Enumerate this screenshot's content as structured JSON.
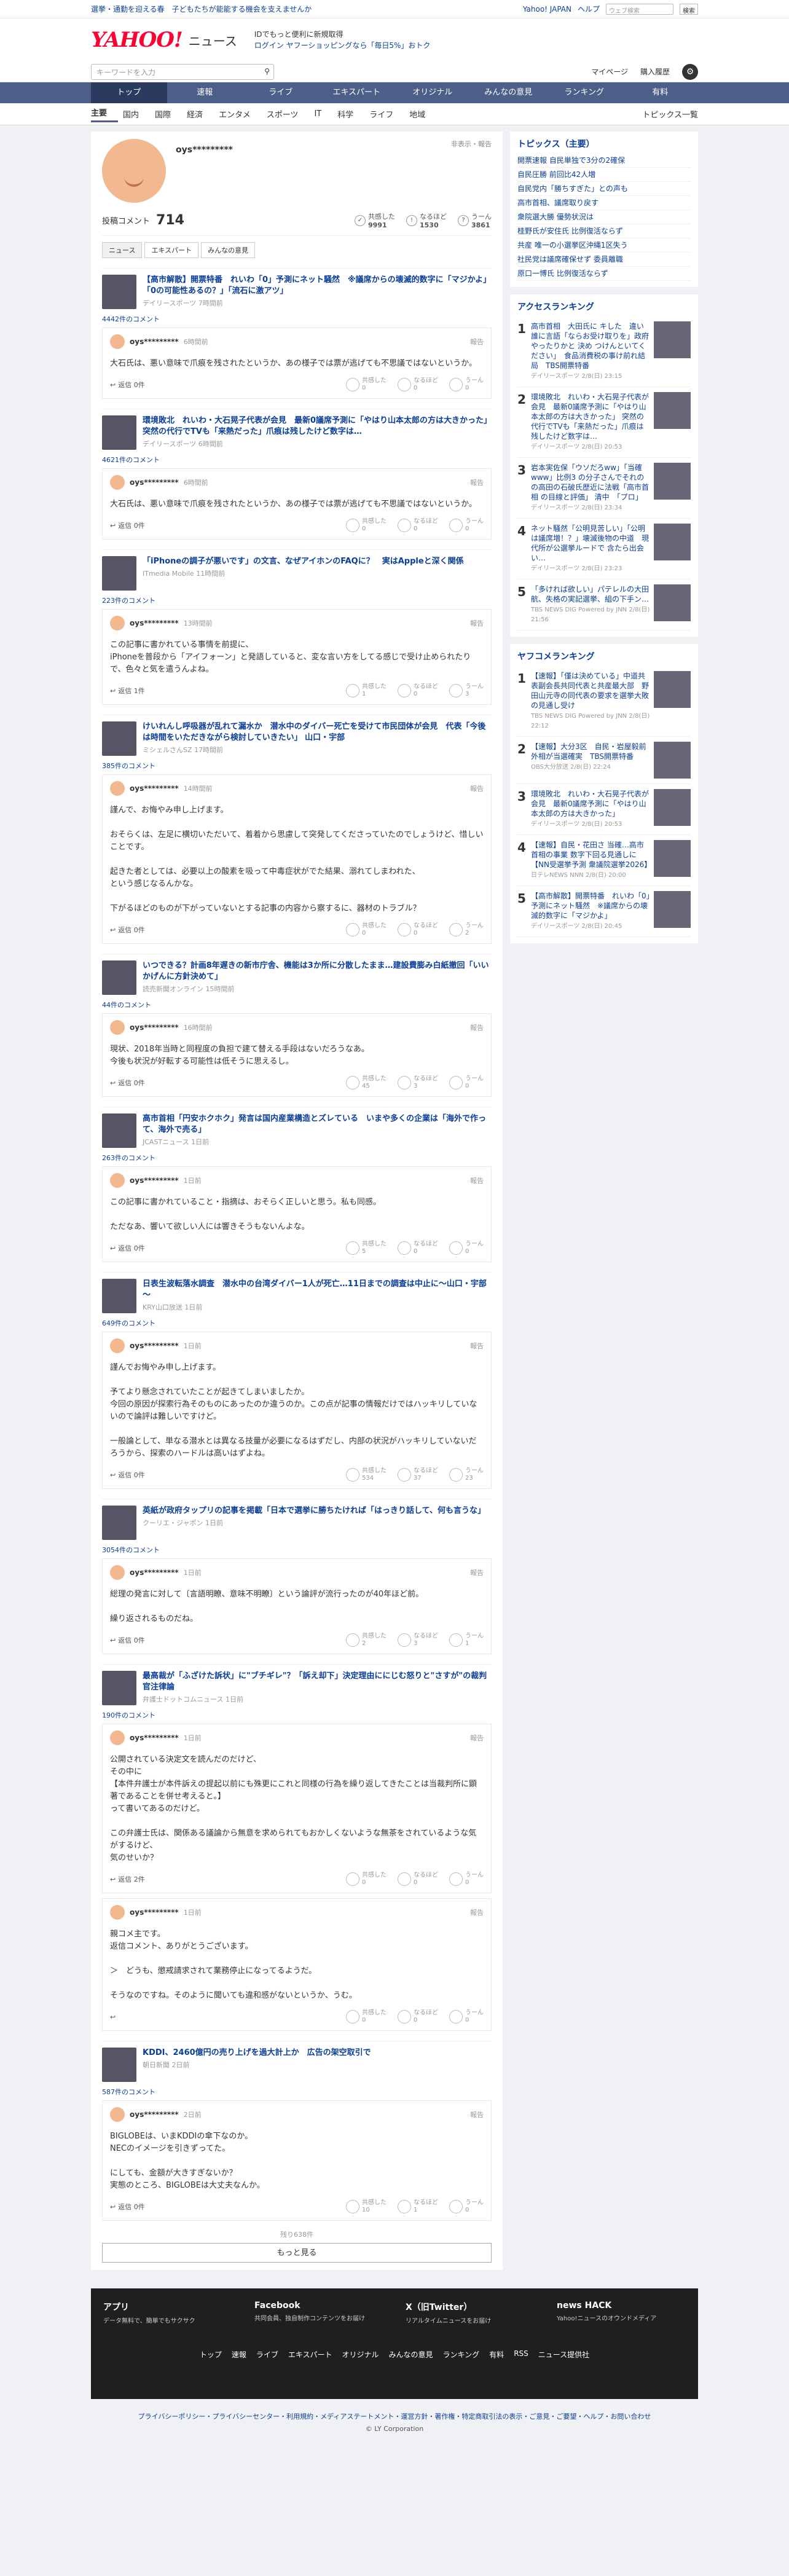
{
  "topbar": {
    "promo": "選挙・通勤を迎える春　子どもたちが能能する機会を支えませんか",
    "links": [
      "Yahoo! JAPAN",
      "ヘルプ"
    ],
    "search_placeholder": "ウェブ検索",
    "search_btn": "検索"
  },
  "header": {
    "logo": "YAHOO!",
    "logo_sub": "ニュース",
    "msg1": "IDでもっと便利に新規取得",
    "msg2": "ログイン ヤフーショッピングなら「毎日5%」おトク"
  },
  "search": {
    "placeholder": "キーワードを入力",
    "links": [
      "マイページ",
      "購入履歴"
    ]
  },
  "nav1": [
    "トップ",
    "速報",
    "ライブ",
    "エキスパート",
    "オリジナル",
    "みんなの意見",
    "ランキング",
    "有料"
  ],
  "nav2": [
    "主要",
    "国内",
    "国際",
    "経済",
    "エンタメ",
    "スポーツ",
    "IT",
    "科学",
    "ライフ",
    "地域"
  ],
  "nav2_right": "トピックス一覧",
  "profile": {
    "name": "oys*********",
    "meta": "非表示・報告",
    "label": "投稿コメント",
    "count": "714",
    "reacts": [
      {
        "label": "共感した",
        "num": "9991"
      },
      {
        "label": "なるほど",
        "num": "1530"
      },
      {
        "label": "うーん",
        "num": "3861"
      }
    ]
  },
  "tabs": [
    "ニュース",
    "エキスパート",
    "みんなの意見"
  ],
  "react_labels": [
    "共感した",
    "なるほど",
    "うーん"
  ],
  "articles": [
    {
      "title": "【高市解散】開票特番　れいわ「0」予測にネット騒然　※議席からの壊滅的数字に「マジかよ」「0の可能性あるの？」「流石に激アツ」",
      "src": "デイリースポーツ 7時間前",
      "count": "4442件のコメント",
      "comments": [
        {
          "name": "oys*********",
          "time": "6時間前",
          "body": "大石氏は、悪い意味で爪痕を残されたというか、あの様子では票が逃げても不思議ではないというか。",
          "reply": "返信 0件",
          "r": [
            "0",
            "0",
            "0"
          ]
        }
      ]
    },
    {
      "title": "環境敗北　れいわ・大石晃子代表が会見　最新0議席予測に「やはり山本太郎の方は大きかった」　突然の代行でTVも「来熱だった」爪痕は残したけど数字は…",
      "src": "デイリースポーツ 6時間前",
      "count": "4621件のコメント",
      "comments": [
        {
          "name": "oys*********",
          "time": "6時間前",
          "body": "大石氏は、悪い意味で爪痕を残されたというか、あの様子では票が逃げても不思議ではないというか。",
          "reply": "返信 0件",
          "r": [
            "0",
            "0",
            "0"
          ]
        }
      ]
    },
    {
      "title": "「iPhoneの調子が悪いです」の文言、なぜアイホンのFAQに？　実はAppleと深く関係",
      "src": "ITmedia Mobile 11時間前",
      "count": "223件のコメント",
      "comments": [
        {
          "name": "oys*********",
          "time": "13時間前",
          "body": "この記事に書かれている事情を前提に、\niPhoneを普段から「アイフォーン」と発語していると、変な言い方をしてる感じで受け止められたりで、色々と気を遣うんよね。",
          "reply": "返信 1件",
          "r": [
            "1",
            "0",
            "3"
          ]
        }
      ]
    },
    {
      "title": "けいれんし呼吸器が乱れて漏水か　潜水中のダイバー死亡を受けて市民団体が会見　代表「今後は時間をいただきながら検討していきたい」 山口・宇部",
      "src": "ミシェルさんSZ 17時間前",
      "count": "385件のコメント",
      "comments": [
        {
          "name": "oys*********",
          "time": "14時間前",
          "body": "謹んで、お悔やみ申し上げます。\n\nおそらくは、左足に横切いただいて、着着から思慮して突発してくださっていたのでしょうけど、惜しいことです。\n\n起きた者としては、必要以上の酸素を吸って中毒症状がでた結果、溺れてしまわれた、\nという感じなるんかな。\n\n下がるほどのものが下がっていないとする記事の内容から察するに、器材のトラブル？",
          "reply": "返信 0件",
          "r": [
            "0",
            "0",
            "2"
          ]
        }
      ]
    },
    {
      "title": "いつできる？計画8年遅きの新市庁舎、機能は3か所に分散したまま…建設費膨み白紙撤回「いいかげんに方針決めて」",
      "src": "読売新聞オンライン 15時間前",
      "count": "44件のコメント",
      "comments": [
        {
          "name": "oys*********",
          "time": "16時間前",
          "body": "現状、2018年当時と同程度の負担で建て替える手段はないだろうなあ。\n今後も状況が好転する可能性は低そうに思えるし。",
          "reply": "返信 0件",
          "r": [
            "45",
            "3",
            "0"
          ]
        }
      ]
    },
    {
      "title": "高市首相「円安ホクホク」発言は国内産業構造とズレている　いまや多くの企業は「海外で作って、海外で売る」",
      "src": "JCASTニュース 1日前",
      "count": "263件のコメント",
      "comments": [
        {
          "name": "oys*********",
          "time": "1日前",
          "body": "この記事に書かれていること・指摘は、おそらく正しいと思う。私も同感。\n\nただなあ、響いて欲しい人には響きそうもないんよな。",
          "reply": "返信 0件",
          "r": [
            "5",
            "0",
            "0"
          ]
        }
      ]
    },
    {
      "title": "日表生波転落水調査　潜水中の台湾ダイバー1人が死亡…11日までの調査は中止に～山口・宇部～",
      "src": "KRY山口放送 1日前",
      "count": "649件のコメント",
      "comments": [
        {
          "name": "oys*********",
          "time": "1日前",
          "body": "謹んでお悔やみ申し上げます。\n\n予てより懸念されていたことが起きてしまいましたか。\n今回の原因が探索行為そのものにあったのか違うのか。この点が記事の情報だけではハッキリしていないので論評は難しいですけど。\n\n一般論として、単なる潜水とは異なる技量が必要になるはずだし、内部の状況がハッキリしていないだろうから、探索のハードルは高いはずよね。",
          "reply": "返信 0件",
          "r": [
            "534",
            "37",
            "23"
          ]
        }
      ]
    },
    {
      "title": "英紙が政府タップリの記事を掲載「日本で選挙に勝ちたければ「はっきり話して、何も言うな」",
      "src": "クーリエ・ジャポン 1日前",
      "count": "3054件のコメント",
      "comments": [
        {
          "name": "oys*********",
          "time": "1日前",
          "body": "総理の発言に対して〔言語明瞭、意味不明瞭〕という論評が流行ったのが40年ほど前。\n\n繰り返されるものだね。",
          "reply": "返信 0件",
          "r": [
            "2",
            "3",
            "1"
          ]
        }
      ]
    },
    {
      "title": "最高裁が「ふざけた訴状」に\"ブチギレ\"？「訴え却下」決定理由ににじむ怒りと\"さすが\"の裁判官注律論",
      "src": "弁護士ドットコムニュース 1日前",
      "count": "190件のコメント",
      "comments": [
        {
          "name": "oys*********",
          "time": "1日前",
          "body": "公開されている決定文を読んだのだけど、\nその中に\n【本件弁護士が本件訴えの提起以前にも殊更にこれと同様の行為を繰り返してきたことは当裁判所に顕著であることを併せ考えると。】\nって書いてあるのだけど。\n\nこの弁護士氏は、関係ある議論から無意を求められてもおかしくないような無茶をされているような気がするけど、\n気のせいか？",
          "reply": "返信 2件",
          "r": [
            "0",
            "0",
            "0"
          ]
        },
        {
          "name": "oys*********",
          "time": "1日前",
          "body": "親コメ主です。\n返信コメント、ありがとうございます。\n\n＞　どうも、懲戒請求されて業務停止になってるようだ。\n\nそうなのですね。そのように聞いても違和感がないというか、うむ。",
          "reply": "",
          "r": [
            "0",
            "0",
            "0"
          ]
        }
      ]
    },
    {
      "title": "KDDI、2460億円の売り上げを過大計上か　広告の架空取引で",
      "src": "朝日新聞 2日前",
      "count": "587件のコメント",
      "comments": [
        {
          "name": "oys*********",
          "time": "2日前",
          "body": "BIGLOBEは、いまKDDIの傘下なのか。\nNECのイメージを引きずってた。\n\nにしても、金額が大きすぎないか？\n実態のところ、BIGLOBEは大丈夫なんか。",
          "reply": "返信 0件",
          "r": [
            "10",
            "1",
            "0"
          ]
        }
      ]
    }
  ],
  "more": {
    "remaining": "残り638件",
    "button": "もっと見る"
  },
  "side": {
    "topics_title": "トピックス（主要）",
    "topics": [
      "開票速報 自民単独で3分の2確保",
      "自民圧勝 前回比42人増",
      "自民党内「勝ちすぎた」との声も",
      "高市首相、議席取り戻す",
      "衆院選大勝 優勢状況は",
      "桂野氏が安住氏 比例復活ならず",
      "共産 唯一の小選挙区沖縄1区失う",
      "社民党は議席確保せず 委員離職",
      "原口一博氏 比例復活ならず"
    ],
    "access_title": "アクセスランキング",
    "access": [
      {
        "t": "高市首相　大田氏に キした　違い誰に言語「ならお受け取りを」政府やったりかと 決め つけんといてください」　食品消費税の事け前れ結局　TBS開票特番",
        "s": "デイリースポーツ 2/8(日) 23:15"
      },
      {
        "t": "環境敗北　れいわ・大石晃子代表が会見　最新0議席予測に「やはり山本太郎の方は大きかった」 突然の代行でTVも「来熱だった」爪痕は残したけど数字は…",
        "s": "デイリースポーツ 2/8(日) 20:53"
      },
      {
        "t": "岩本実佐保「ウソだろww」「当確www」比例3 の分子さんでそれのの高田の石破氏歴近に法戦「高市首相 の目線と評価」 清中　「プロ」",
        "s": "デイリースポーツ 2/8(日) 23:34"
      },
      {
        "t": "ネット騒然「公明見苦しい」「公明は議席増！？」壊滅後物の中道　現代所が公選挙ルードで 含たら出会い…",
        "s": "デイリースポーツ 2/8(日) 23:23"
      },
      {
        "t": "「多ければ欲しい」パテレルの大田航、失格の実記選挙、組の下手ン…",
        "s": "TBS NEWS DIG Powered by JNN 2/8(日) 21:56"
      }
    ],
    "comment_title": "ヤフコメランキング",
    "comment": [
      {
        "t": "【速報】「僅は決めている」中道共表副会長共同代表と共産最大部　野田山元寺の同代表の要求を選挙大敗の見通し受け",
        "s": "TBS NEWS DIG Powered by JNN 2/8(日) 22:12"
      },
      {
        "t": "【速報】大分3区　自民・岩屋毅前外相が当選確実　TBS開票特番",
        "s": "OBS大分放送 2/8(日) 22:24"
      },
      {
        "t": "環境敗北　れいわ・大石晃子代表が会見　最新0議席予測に「やはり山本太郎の方は大きかった」",
        "s": "デイリースポーツ 2/8(日) 20:53"
      },
      {
        "t": "【速報】自民・花田さ 当確…高市首相の事業 数字下回る見通しに【NN受選挙予測 衆議院選挙2026】",
        "s": "日テレNEWS NNN 2/8(日) 20:00"
      },
      {
        "t": "【高市解散】開票特番　れいわ「0」予測にネット騒然　※議席からの壊滅的数字に「マジかよ」",
        "s": "デイリースポーツ 2/8(日) 20:45"
      }
    ]
  },
  "footer": {
    "social": [
      {
        "n": "アプリ",
        "d": "データ無料で、簡単でもサクサク"
      },
      {
        "n": "Facebook",
        "d": "共同会員、独自制作コンテンツをお届け"
      },
      {
        "n": "X（旧Twitter）",
        "d": "リアルタイムニュースをお届け"
      },
      {
        "n": "news HACK",
        "d": "Yahoo!ニュースのオウンドメディア"
      }
    ],
    "links": [
      "トップ",
      "速報",
      "ライブ",
      "エキスパート",
      "オリジナル",
      "みんなの意見",
      "ランキング",
      "有料",
      "RSS",
      "ニュース提供社"
    ],
    "legal": "プライバシーポリシー・プライバシーセンター・利用規約・メディアステートメント・運営方針・著作権・特定商取引法の表示・ご意見・ご要望・ヘルプ・お問い合わせ",
    "copy": "© LY Corporation"
  }
}
